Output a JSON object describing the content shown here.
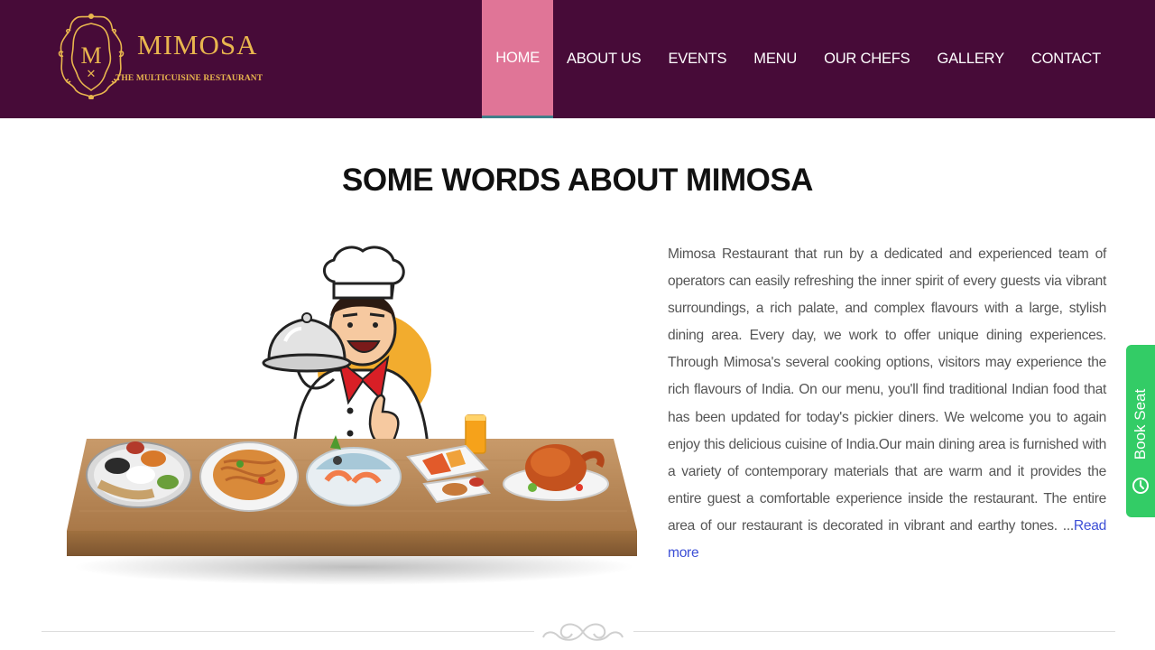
{
  "brand": {
    "name": "MIMOSA",
    "tagline": "THE MULTICUISINE RESTAURANT",
    "monogram": "M",
    "colors": {
      "header_bg": "#470b38",
      "gold": "#e9b64e",
      "active_tab": "#e07597"
    }
  },
  "nav": {
    "items": [
      {
        "label": "HOME",
        "active": true
      },
      {
        "label": "ABOUT US"
      },
      {
        "label": "EVENTS"
      },
      {
        "label": "MENU"
      },
      {
        "label": "OUR CHEFS"
      },
      {
        "label": "GALLERY"
      },
      {
        "label": "CONTACT"
      }
    ]
  },
  "about": {
    "title": "SOME WORDS ABOUT MIMOSA",
    "body": "Mimosa Restaurant that run by a dedicated and experienced team of operators can easily refreshing the inner spirit of every guests via vibrant surroundings, a rich palate, and complex flavours with a large, stylish dining area. Every day, we work to offer unique dining experiences. Through Mimosa's several cooking options, visitors may experience the rich flavours of India. On our menu, you'll find traditional Indian food that has been updated for today's pickier diners. We welcome you to again enjoy this delicious cuisine of India.Our main dining area is furnished with a variety of contemporary materials that are warm and it provides the entire guest a comfortable experience inside the restaurant. The entire area of our restaurant is decorated in vibrant and earthy tones. ...",
    "read_more": "Read more",
    "image_icon": "chef-with-food-table-illustration"
  },
  "book_seat": {
    "label": "Book Seat",
    "icon": "clock-icon",
    "color": "#33cc66"
  },
  "divider": {
    "icon": "ornament-flourish-icon"
  }
}
